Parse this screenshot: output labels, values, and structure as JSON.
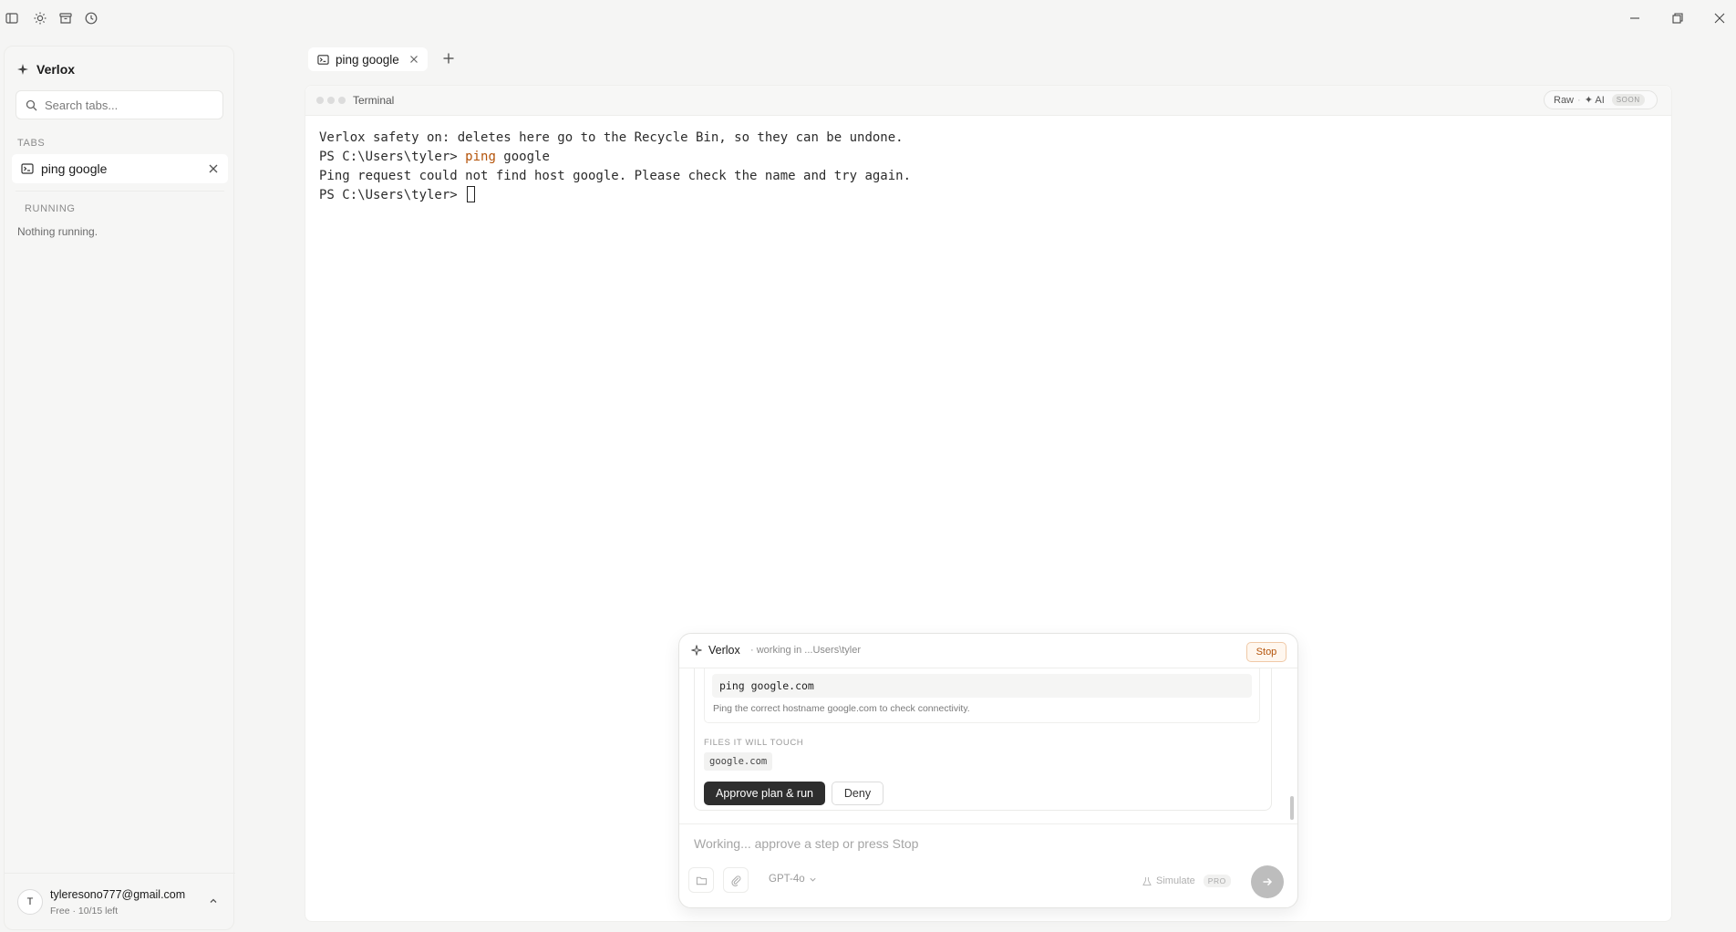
{
  "titlebar": {
    "icons": [
      "sidebar-toggle-icon",
      "sun-icon",
      "archive-icon",
      "history-icon"
    ],
    "window_controls": [
      "minimize-icon",
      "restore-icon",
      "close-icon"
    ]
  },
  "sidebar": {
    "brand": "Verlox",
    "search_placeholder": "Search tabs...",
    "tabs_heading": "TABS",
    "tabs": [
      {
        "label": "ping google",
        "icon": "terminal-icon"
      }
    ],
    "running_heading": "RUNNING",
    "running_empty": "Nothing running.",
    "account": {
      "avatar": "T",
      "email": "tyleresono777@gmail.com",
      "plan": "Free · 10/15 left"
    }
  },
  "tabstrip": {
    "active_tab": "ping google",
    "new_tab_icon": "plus-icon"
  },
  "terminal": {
    "title": "Terminal",
    "mode_raw": "Raw",
    "mode_ai": "✦ AI",
    "soon_badge": "SOON",
    "lines": {
      "safety": "Verlox safety on: deletes here go to the Recycle Bin, so they can be undone.",
      "prompt1": "PS C:\\Users\\tyler> ",
      "cmd1_verb": "ping",
      "cmd1_arg": " google",
      "error": "Ping request could not find host google. Please check the name and try again.",
      "prompt2": "PS C:\\Users\\tyler> "
    }
  },
  "composer": {
    "title": "Verlox",
    "status": "· working in ...Users\\tyler",
    "stop_label": "Stop",
    "plan": {
      "command": "ping google.com",
      "description": "Ping the correct hostname google.com to check connectivity.",
      "files_heading": "FILES IT WILL TOUCH",
      "files": [
        "google.com"
      ],
      "approve_label": "Approve plan & run",
      "deny_label": "Deny"
    },
    "input_placeholder": "Working... approve a step or press Stop",
    "model": "GPT-4o",
    "simulate_label": "Simulate",
    "pro_badge": "PRO"
  },
  "colors": {
    "accent_command": "#b45309",
    "approve_button": "#2e2e2e",
    "stop_border": "#f0c9a7"
  }
}
